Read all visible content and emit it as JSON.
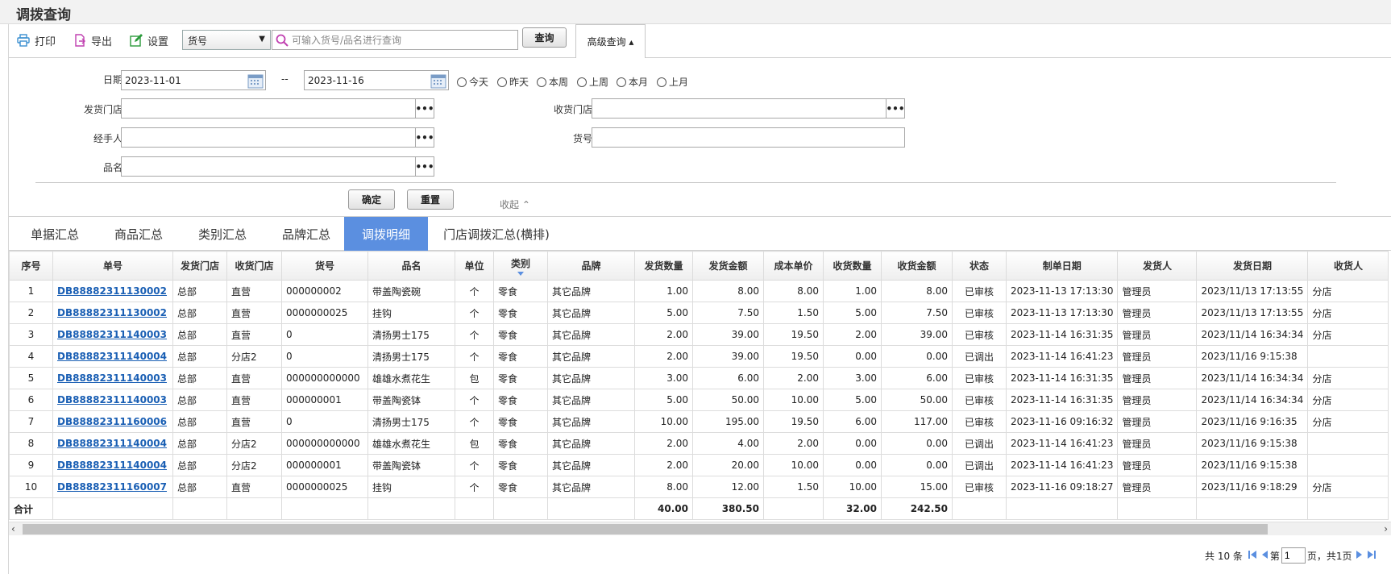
{
  "page_title": "调拨查询",
  "toolbar": {
    "print_label": "打印",
    "export_label": "导出",
    "settings_label": "设置",
    "search_field_selected": "货号",
    "search_placeholder": "可输入货号/品名进行查询",
    "query_label": "查询",
    "advanced_label": "高级查询 ▴"
  },
  "filter": {
    "date_label": "日期:",
    "date_from": "2023-11-01",
    "date_sep": "--",
    "date_to": "2023-11-16",
    "quick_ranges": [
      "今天",
      "昨天",
      "本周",
      "上周",
      "本月",
      "上月"
    ],
    "send_store_label": "发货门店:",
    "recv_store_label": "收货门店:",
    "handler_label": "经手人:",
    "item_no_label": "货号:",
    "item_name_label": "品名:",
    "dots": "•••",
    "confirm_label": "确定",
    "reset_label": "重置",
    "collapse_label": "收起 ⌃"
  },
  "tabs": [
    {
      "label": "单据汇总",
      "active": false
    },
    {
      "label": "商品汇总",
      "active": false
    },
    {
      "label": "类别汇总",
      "active": false
    },
    {
      "label": "品牌汇总",
      "active": false
    },
    {
      "label": "调拨明细",
      "active": true
    },
    {
      "label": "门店调拨汇总(横排)",
      "active": false
    }
  ],
  "table": {
    "columns": [
      "序号",
      "单号",
      "发货门店",
      "收货门店",
      "货号",
      "品名",
      "单位",
      "类别",
      "品牌",
      "发货数量",
      "发货金额",
      "成本单价",
      "收货数量",
      "收货金额",
      "状态",
      "制单日期",
      "发货人",
      "发货日期",
      "收货人"
    ],
    "rows": [
      [
        "1",
        "DB88882311130002",
        "总部",
        "直营",
        "000000002",
        "带盖陶瓷碗",
        "个",
        "零食",
        "其它品牌",
        "1.00",
        "8.00",
        "8.00",
        "1.00",
        "8.00",
        "已审核",
        "2023-11-13 17:13:30",
        "管理员",
        "2023/11/13 17:13:55",
        "分店"
      ],
      [
        "2",
        "DB88882311130002",
        "总部",
        "直营",
        "0000000025",
        "挂钩",
        "个",
        "零食",
        "其它品牌",
        "5.00",
        "7.50",
        "1.50",
        "5.00",
        "7.50",
        "已审核",
        "2023-11-13 17:13:30",
        "管理员",
        "2023/11/13 17:13:55",
        "分店"
      ],
      [
        "3",
        "DB88882311140003",
        "总部",
        "直营",
        "0",
        "清扬男士175",
        "个",
        "零食",
        "其它品牌",
        "2.00",
        "39.00",
        "19.50",
        "2.00",
        "39.00",
        "已审核",
        "2023-11-14 16:31:35",
        "管理员",
        "2023/11/14 16:34:34",
        "分店"
      ],
      [
        "4",
        "DB88882311140004",
        "总部",
        "分店2",
        "0",
        "清扬男士175",
        "个",
        "零食",
        "其它品牌",
        "2.00",
        "39.00",
        "19.50",
        "0.00",
        "0.00",
        "已调出",
        "2023-11-14 16:41:23",
        "管理员",
        "2023/11/16 9:15:38",
        ""
      ],
      [
        "5",
        "DB88882311140003",
        "总部",
        "直营",
        "000000000000",
        "雄雄水煮花生",
        "包",
        "零食",
        "其它品牌",
        "3.00",
        "6.00",
        "2.00",
        "3.00",
        "6.00",
        "已审核",
        "2023-11-14 16:31:35",
        "管理员",
        "2023/11/14 16:34:34",
        "分店"
      ],
      [
        "6",
        "DB88882311140003",
        "总部",
        "直营",
        "000000001",
        "带盖陶瓷钵",
        "个",
        "零食",
        "其它品牌",
        "5.00",
        "50.00",
        "10.00",
        "5.00",
        "50.00",
        "已审核",
        "2023-11-14 16:31:35",
        "管理员",
        "2023/11/14 16:34:34",
        "分店"
      ],
      [
        "7",
        "DB88882311160006",
        "总部",
        "直营",
        "0",
        "清扬男士175",
        "个",
        "零食",
        "其它品牌",
        "10.00",
        "195.00",
        "19.50",
        "6.00",
        "117.00",
        "已审核",
        "2023-11-16 09:16:32",
        "管理员",
        "2023/11/16 9:16:35",
        "分店"
      ],
      [
        "8",
        "DB88882311140004",
        "总部",
        "分店2",
        "000000000000",
        "雄雄水煮花生",
        "包",
        "零食",
        "其它品牌",
        "2.00",
        "4.00",
        "2.00",
        "0.00",
        "0.00",
        "已调出",
        "2023-11-14 16:41:23",
        "管理员",
        "2023/11/16 9:15:38",
        ""
      ],
      [
        "9",
        "DB88882311140004",
        "总部",
        "分店2",
        "000000001",
        "带盖陶瓷钵",
        "个",
        "零食",
        "其它品牌",
        "2.00",
        "20.00",
        "10.00",
        "0.00",
        "0.00",
        "已调出",
        "2023-11-14 16:41:23",
        "管理员",
        "2023/11/16 9:15:38",
        ""
      ],
      [
        "10",
        "DB88882311160007",
        "总部",
        "直营",
        "0000000025",
        "挂钩",
        "个",
        "零食",
        "其它品牌",
        "8.00",
        "12.00",
        "1.50",
        "10.00",
        "15.00",
        "已审核",
        "2023-11-16 09:18:27",
        "管理员",
        "2023/11/16 9:18:29",
        "分店"
      ]
    ],
    "total": {
      "label": "合计",
      "send_qty": "40.00",
      "send_amount": "380.50",
      "recv_qty": "32.00",
      "recv_amount": "242.50"
    }
  },
  "pager": {
    "total_text": "共 10 条",
    "page_prefix": "第",
    "page_value": "1",
    "page_suffix": "页，共1页"
  },
  "colors": {
    "accent": "#5b8fe0",
    "link": "#1a5fb4",
    "print_icon": "#3a8fd0",
    "export_icon": "#c040b0",
    "settings_icon": "#2a9a3a"
  }
}
